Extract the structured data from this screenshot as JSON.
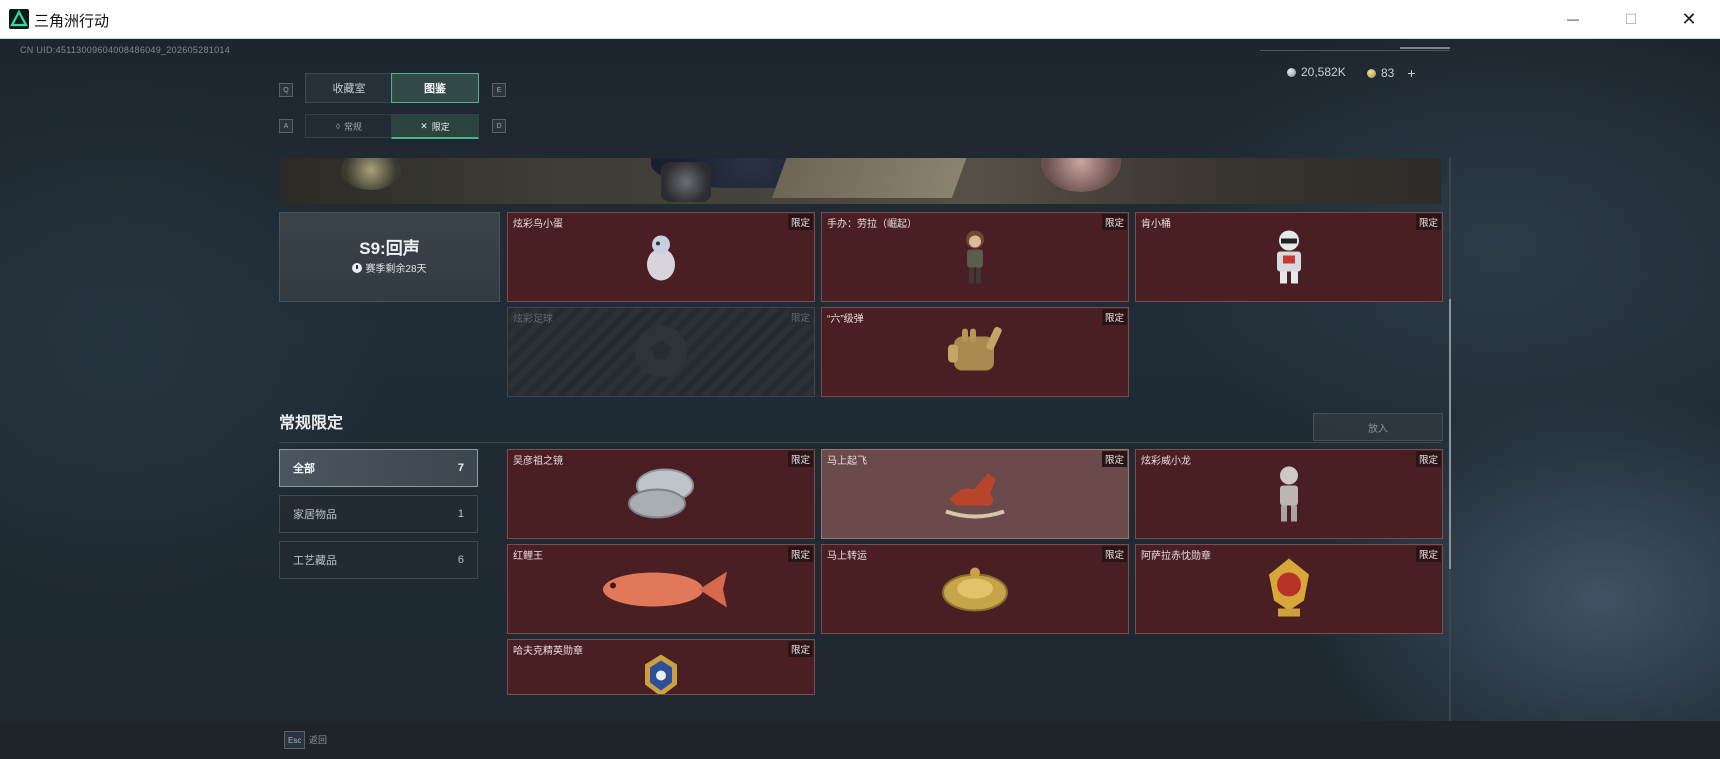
{
  "window": {
    "title": "三角洲行动",
    "minimize_glyph": "—",
    "maximize_glyph": "☐",
    "close_glyph": "✕"
  },
  "hud": {
    "uid": "CN UID:4511300960400848604​9_202605281014",
    "currency1": "20,582K",
    "currency2": "83",
    "plus": "+"
  },
  "keys": {
    "left_tab": "Q",
    "right_tab": "E",
    "left_sub": "A",
    "right_sub": "D",
    "esc": "Esc"
  },
  "tabs": [
    {
      "label": "收藏室"
    },
    {
      "label": "图鉴"
    }
  ],
  "subtabs": [
    {
      "label": "常规",
      "icon": "drop-icon"
    },
    {
      "label": "限定",
      "icon": "crossed-swords-icon"
    }
  ],
  "season": {
    "title": "S9:回声",
    "remaining": "赛季剩余28天"
  },
  "season_items": [
    {
      "name": "炫彩鸟小蛋",
      "tag": "限定",
      "state": "owned",
      "icon": "egg-figure-icon"
    },
    {
      "name": "手办：劳拉（崛起）",
      "tag": "限定",
      "state": "owned",
      "icon": "figurine-icon"
    },
    {
      "name": "肯小桶",
      "tag": "限定",
      "state": "owned",
      "icon": "mascot-figure-icon"
    },
    {
      "name": "炫彩足球",
      "tag": "限定",
      "state": "locked",
      "icon": "football-icon"
    },
    {
      "name": "“六”级弹",
      "tag": "限定",
      "state": "owned",
      "icon": "golden-hand-icon"
    }
  ],
  "section": {
    "title": "常规限定",
    "put_button": "放入"
  },
  "filters": [
    {
      "label": "全部",
      "count": "7"
    },
    {
      "label": "家居物品",
      "count": "1"
    },
    {
      "label": "工艺藏品",
      "count": "6"
    }
  ],
  "regular_items": [
    {
      "name": "吴彦祖之镜",
      "tag": "限定",
      "icon": "mirror-icon"
    },
    {
      "name": "马上起飞",
      "tag": "限定",
      "icon": "rocking-horse-icon"
    },
    {
      "name": "炫彩威小龙",
      "tag": "限定",
      "icon": "figure-statue-icon"
    },
    {
      "name": "红鲤王",
      "tag": "限定",
      "icon": "carp-fish-icon"
    },
    {
      "name": "马上转运",
      "tag": "限定",
      "icon": "golden-disc-icon"
    },
    {
      "name": "阿萨拉赤忱勋章",
      "tag": "限定",
      "icon": "medal-icon"
    },
    {
      "name": "哈夫克精英勋章",
      "tag": "限定",
      "icon": "elite-badge-icon"
    }
  ],
  "bottom": {
    "back_label": "返回"
  },
  "colors": {
    "accent": "#4bb48e",
    "card_bg": "#4a1f24",
    "card_border": "#7d4c51"
  }
}
